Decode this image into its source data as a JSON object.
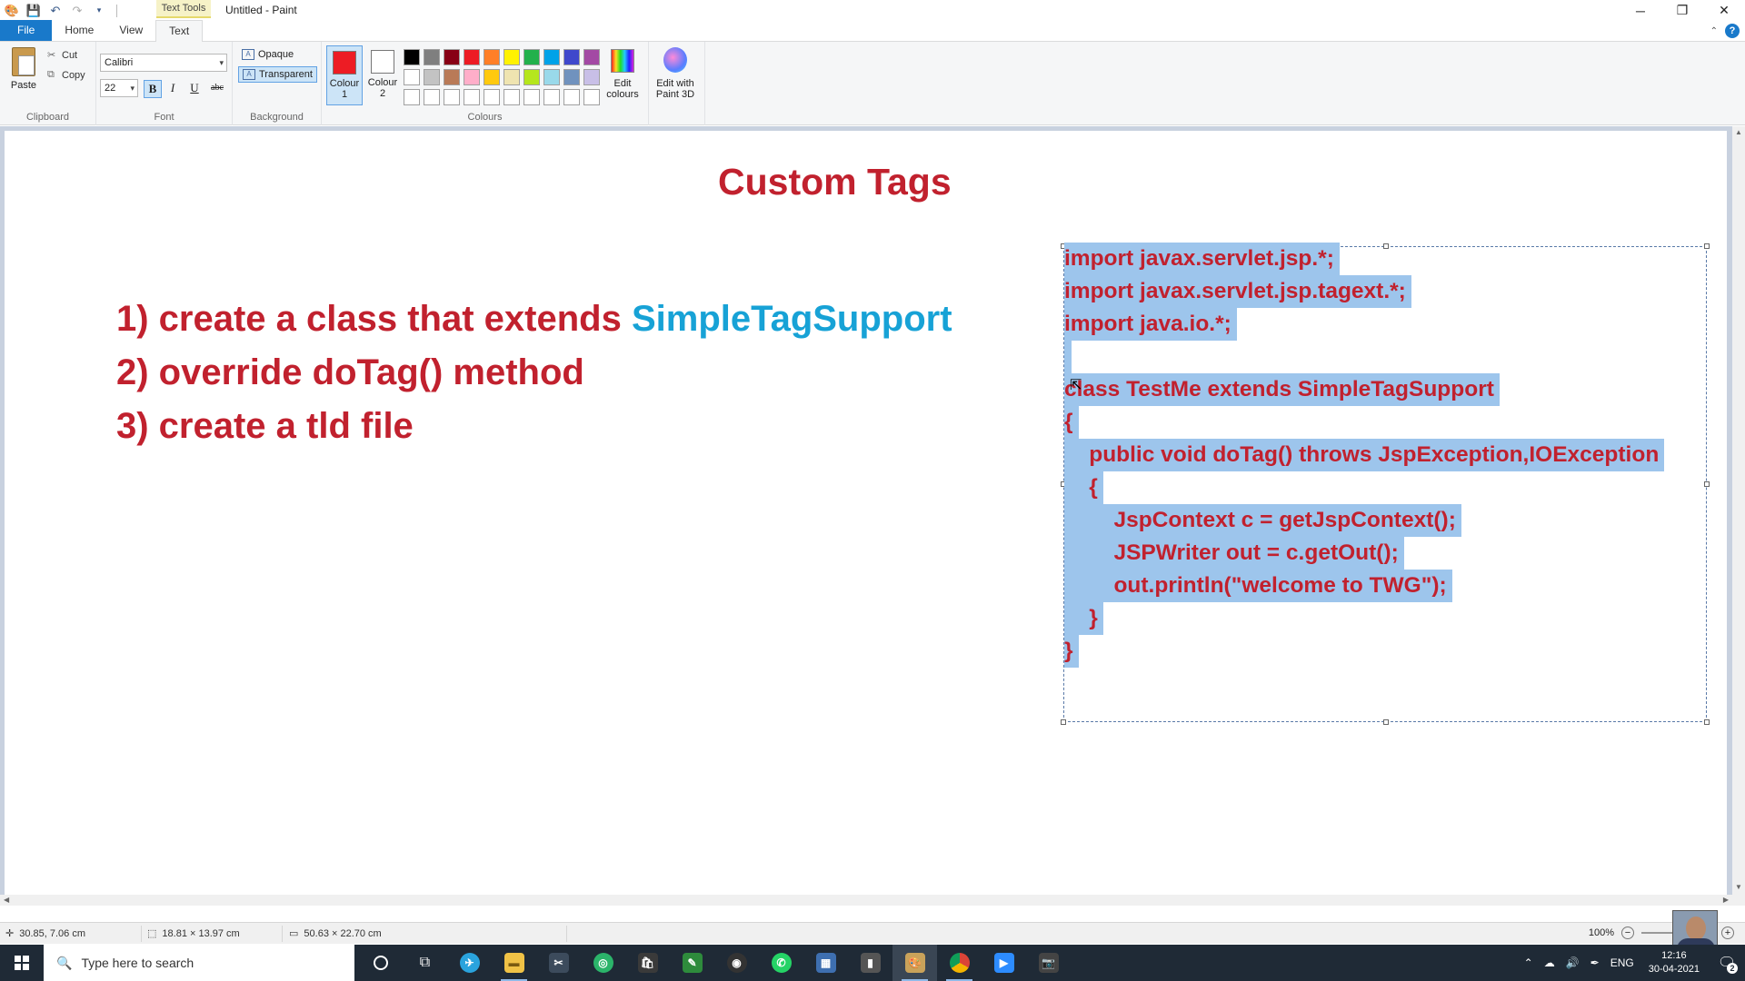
{
  "window": {
    "title": "Untitled - Paint",
    "context_tab": "Text Tools",
    "controls": [
      "─",
      "❐",
      "✕"
    ]
  },
  "ribbon_tabs": [
    {
      "label": "File",
      "kind": "file"
    },
    {
      "label": "Home",
      "kind": "normal"
    },
    {
      "label": "View",
      "kind": "normal"
    },
    {
      "label": "Text",
      "kind": "active"
    }
  ],
  "clipboard": {
    "paste": "Paste",
    "cut": "Cut",
    "copy": "Copy",
    "label": "Clipboard"
  },
  "font": {
    "family": "Calibri",
    "size": "22",
    "bold": "B",
    "italic": "I",
    "underline": "U",
    "strike": "abc",
    "label": "Font"
  },
  "background": {
    "opaque": "Opaque",
    "transparent": "Transparent",
    "label": "Background"
  },
  "colours": {
    "colour1": {
      "line1": "Colour",
      "line2": "1",
      "color": "#ed1c24"
    },
    "colour2": {
      "line1": "Colour",
      "line2": "2",
      "color": "#ffffff"
    },
    "palette": [
      "#000000",
      "#7f7f7f",
      "#880015",
      "#ed1c24",
      "#ff7f27",
      "#fff200",
      "#22b14c",
      "#00a2e8",
      "#3f48cc",
      "#a349a4",
      "#ffffff",
      "#c3c3c3",
      "#b97a57",
      "#ffaec9",
      "#ffc90e",
      "#efe4b0",
      "#b5e61d",
      "#99d9ea",
      "#7092be",
      "#c8bfe7",
      "#ffffff",
      "#ffffff",
      "#ffffff",
      "#ffffff",
      "#ffffff",
      "#ffffff",
      "#ffffff",
      "#ffffff",
      "#ffffff",
      "#ffffff"
    ],
    "edit": {
      "line1": "Edit",
      "line2": "colours"
    },
    "paint3d": {
      "line1": "Edit with",
      "line2": "Paint 3D"
    },
    "label": "Colours"
  },
  "canvas": {
    "title": "Custom Tags",
    "steps": [
      {
        "text": "1) create a class that extends ",
        "highlight": "SimpleTagSupport"
      },
      {
        "text": "2) override doTag() method",
        "highlight": ""
      },
      {
        "text": "3) create a tld file",
        "highlight": ""
      }
    ],
    "code": [
      "import javax.servlet.jsp.*;",
      "import javax.servlet.jsp.tagext.*;",
      "import java.io.*;",
      "",
      "class TestMe extends SimpleTagSupport",
      "{",
      "    public void doTag() throws JspException,IOException",
      "    {",
      "        JspContext c = getJspContext();",
      "        JSPWriter out = c.getOut();",
      "        out.println(\"welcome to TWG\");",
      "    }",
      "}"
    ],
    "text_color": "#c1212e",
    "highlight_color": "#17a2d6",
    "selection_color": "#9dc5ec"
  },
  "status": {
    "cursor": "30.85, 7.06 cm",
    "selection": "18.81 × 13.97 cm",
    "image_size": "50.63 × 22.70 cm",
    "zoom": "100%"
  },
  "taskbar": {
    "search_placeholder": "Type here to search",
    "lang": "ENG",
    "time": "12:16",
    "date": "30-04-2021",
    "notif_count": "2"
  }
}
